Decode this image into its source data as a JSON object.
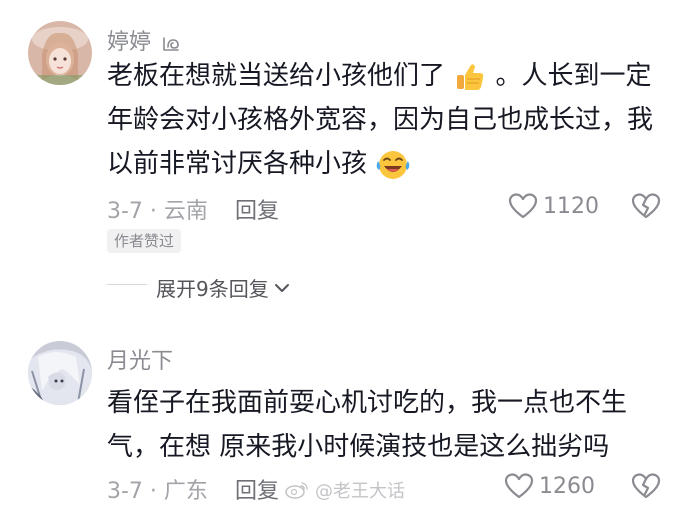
{
  "comments": [
    {
      "username": "婷婷",
      "content_lines": [
        "老板在想就当送给小孩他们了",
        "。人长到一定",
        "年龄会对小孩格外宽容，因为自己也成长过，我",
        "以前非常讨厌各种小孩"
      ],
      "date_location": "3-7 · 云南",
      "reply_label": "回复",
      "like_count": "1120",
      "author_badge": "作者赞过",
      "expand_replies": "展开9条回复"
    },
    {
      "username": "月光下",
      "content_lines": [
        "看侄子在我面前耍心机讨吃的，我一点也不生",
        "气，在想 原来我小时候演技也是这么拙劣吗"
      ],
      "date_location": "3-7 · 广东",
      "reply_label": "回复",
      "like_count": "1260"
    }
  ],
  "watermark": "@老王大话",
  "icons": {
    "heart": "heart-outline-icon",
    "dislike": "broken-heart-icon",
    "emoji1": "thumbs-up-emoji",
    "emoji2": "laughing-crying-emoji",
    "weibo": "weibo-logo-icon"
  }
}
